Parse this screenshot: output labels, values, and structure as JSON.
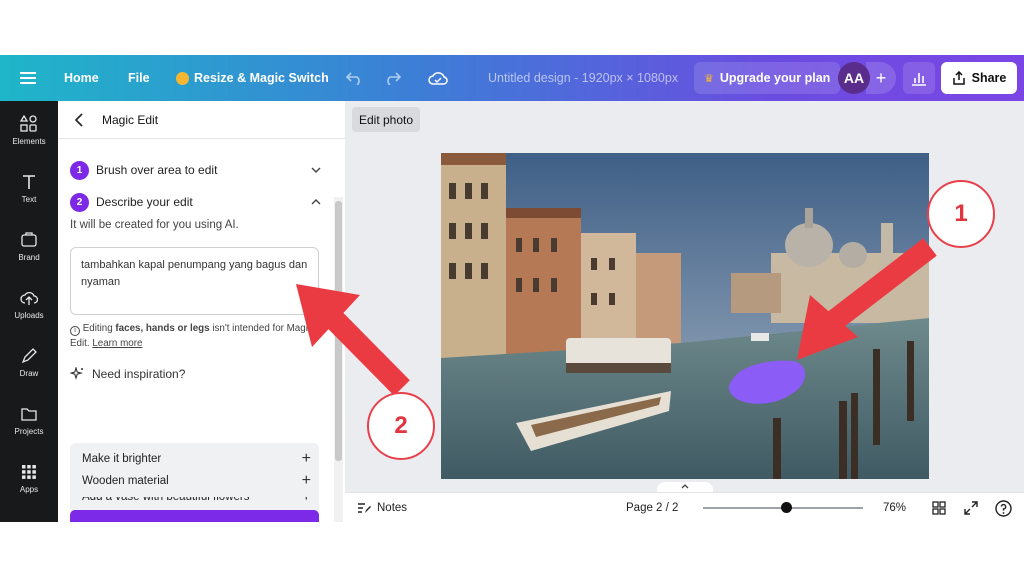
{
  "topbar": {
    "home": "Home",
    "file": "File",
    "resize": "Resize & Magic Switch",
    "title": "Untitled design - 1920px × 1080px",
    "upgrade": "Upgrade your plan",
    "avatar": "AA",
    "share": "Share"
  },
  "rail": [
    {
      "label": "Elements",
      "icon": "elements-icon"
    },
    {
      "label": "Text",
      "icon": "text-icon"
    },
    {
      "label": "Brand",
      "icon": "brand-icon"
    },
    {
      "label": "Uploads",
      "icon": "upload-cloud-icon"
    },
    {
      "label": "Draw",
      "icon": "draw-icon"
    },
    {
      "label": "Projects",
      "icon": "folder-icon"
    },
    {
      "label": "Apps",
      "icon": "apps-grid-icon"
    }
  ],
  "panel": {
    "title": "Magic Edit",
    "step1": {
      "num": "1",
      "label": "Brush over area to edit"
    },
    "step2": {
      "num": "2",
      "label": "Describe your edit"
    },
    "ai_note": "It will be created for you using AI.",
    "prompt": "tambahkan kapal penumpang yang bagus dan nyaman",
    "warn_pre": "Editing ",
    "warn_bold": "faces, hands or legs",
    "warn_post": " isn't intended for Magic Edit. ",
    "learn_more": "Learn more",
    "inspiration": "Need inspiration?",
    "suggestions": [
      "Make it brighter",
      "Add a vase with beautiful flowers",
      "Wooden material"
    ]
  },
  "canvas": {
    "edit_photo": "Edit photo"
  },
  "bottombar": {
    "notes": "Notes",
    "page": "Page 2 / 2",
    "zoom": "76%"
  },
  "annotations": {
    "callout1": "1",
    "callout2": "2"
  },
  "colors": {
    "accent_purple": "#7d2ae8",
    "annotation_red": "#e8404a",
    "brush_mark": "#8b5cf6"
  }
}
